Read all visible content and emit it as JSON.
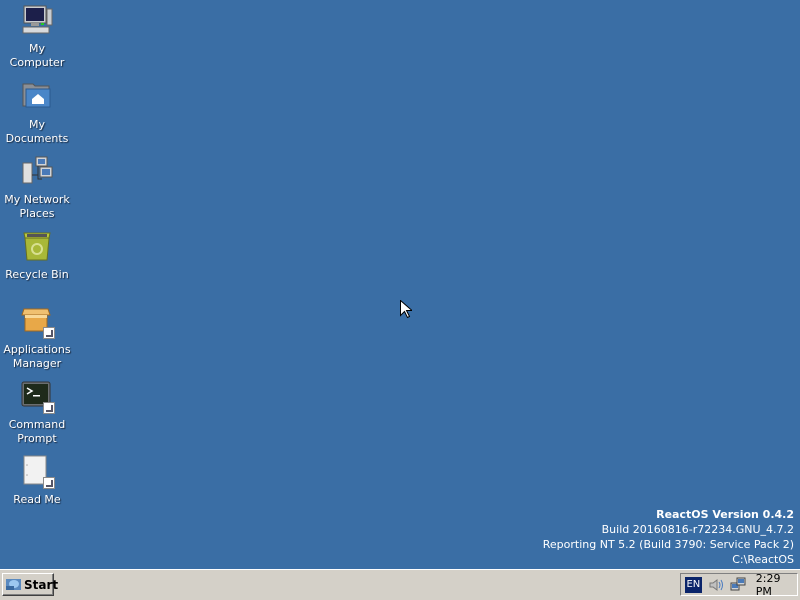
{
  "desktop": {
    "icons": [
      {
        "label": "My Computer",
        "icon": "computer-icon"
      },
      {
        "label": "My Documents",
        "icon": "documents-folder-icon"
      },
      {
        "label": "My Network Places",
        "icon": "network-places-icon"
      },
      {
        "label": "Recycle Bin",
        "icon": "recycle-bin-icon"
      },
      {
        "label": "Applications Manager",
        "icon": "applications-manager-icon"
      },
      {
        "label": "Command Prompt",
        "icon": "command-prompt-icon"
      },
      {
        "label": "Read Me",
        "icon": "document-icon"
      }
    ],
    "version_info": {
      "title": "ReactOS Version 0.4.2",
      "build": "Build 20160816-r72234.GNU_4.7.2",
      "reporting": "Reporting NT 5.2 (Build 3790: Service Pack 2)",
      "path": "C:\\ReactOS"
    }
  },
  "taskbar": {
    "start_label": "Start",
    "tray": {
      "language": "EN",
      "clock": "2:29 PM"
    }
  },
  "colors": {
    "desktop_background": "#3a6ea5",
    "taskbar": "#d4d0c8",
    "language_indicator": "#0a246a"
  }
}
